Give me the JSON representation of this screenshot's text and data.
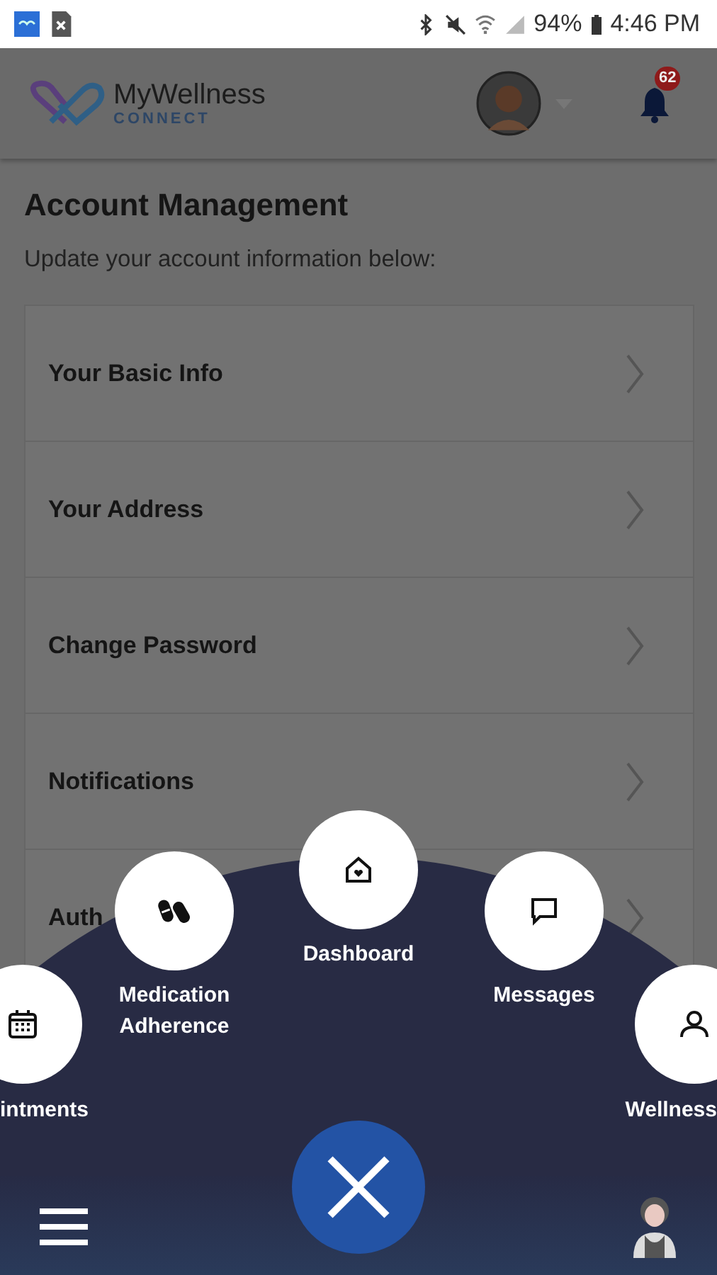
{
  "status_bar": {
    "battery": "94%",
    "time": "4:46 PM"
  },
  "header": {
    "logo_title": "MyWellness",
    "logo_subtitle": "CONNECT",
    "notification_count": "62"
  },
  "title": "Account Management",
  "subtitle": "Update your account information below:",
  "rows": [
    {
      "label": "Your Basic Info"
    },
    {
      "label": "Your Address"
    },
    {
      "label": "Change Password"
    },
    {
      "label": "Notifications"
    },
    {
      "label": "Auth"
    }
  ],
  "menu": {
    "items": [
      {
        "label": "intments"
      },
      {
        "label": "Medication Adherence"
      },
      {
        "label": "Dashboard"
      },
      {
        "label": "Messages"
      },
      {
        "label": "Wellness"
      }
    ]
  }
}
